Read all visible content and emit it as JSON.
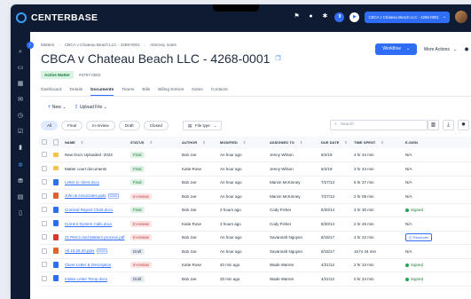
{
  "app": {
    "brand": "CENTERBASE"
  },
  "topbar": {
    "matter_pill": "CBCA v Chateau Beach LLC - 4268-0001",
    "counter_badge": "9"
  },
  "breadcrumb": [
    "Matters",
    "CBCA v Chateau Beach LLC - 4268-0001",
    "Attorney notes"
  ],
  "header": {
    "title": "CBCA v Chateau Beach LLC - 4268-0001",
    "status_badge": "Active Matter",
    "matter_number": "#3797-0002",
    "workflow_label": "Workflow",
    "more_actions_label": "More Actions"
  },
  "tabs": [
    {
      "label": "Dashboard",
      "active": false
    },
    {
      "label": "Details",
      "active": false
    },
    {
      "label": "Documents",
      "active": true
    },
    {
      "label": "Teams",
      "active": false
    },
    {
      "label": "Bills",
      "active": false
    },
    {
      "label": "Billing Entries",
      "active": false
    },
    {
      "label": "Notes",
      "active": false
    },
    {
      "label": "Contacts",
      "active": false
    }
  ],
  "toolbar": {
    "new_label": "New",
    "upload_label": "Upload File"
  },
  "filters": {
    "pills": [
      "All",
      "Final",
      "In-review",
      "Draft",
      "Closed"
    ],
    "active": "All",
    "filetype_label": "File type"
  },
  "search": {
    "placeholder": "Search"
  },
  "table": {
    "columns": [
      "NAME",
      "STATUS",
      "AUTHOR",
      "MODIFIED",
      "ASSIGNED TO",
      "DUE DATE",
      "TIME SPENT",
      "E-SIGN"
    ],
    "rows": [
      {
        "icon": "folder",
        "name": "New Docs Uploaded -2023",
        "link": false,
        "tag": "",
        "status": "Final",
        "author": "Bob Joe",
        "modified": "An hour ago",
        "assigned": "Jenny Wilson",
        "due": "8/2/19",
        "time": "4 hr 34 min",
        "esign": "N/A"
      },
      {
        "icon": "folder",
        "name": "Matter court documents",
        "link": false,
        "tag": "",
        "status": "Final",
        "author": "Katie Rose",
        "modified": "An hour ago",
        "assigned": "Jenny Wilson",
        "due": "8/2/19",
        "time": "3 hr 44 min",
        "esign": "N/A"
      },
      {
        "icon": "word",
        "name": "Letter to client.docx",
        "link": true,
        "tag": "",
        "status": "Final",
        "author": "Bob Joe",
        "modified": "An hour ago",
        "assigned": "Marvin McKinney",
        "due": "7/27/13",
        "time": "5 hr 37 min",
        "esign": "N/A"
      },
      {
        "icon": "ppt",
        "name": "John & Associates.pptx",
        "link": true,
        "tag": "SDDS",
        "status": "In-review",
        "author": "Bob Joe",
        "modified": "An hour ago",
        "assigned": "Marvin McKinney",
        "due": "7/27/13",
        "time": "2 hr 09 min",
        "esign": "N/A"
      },
      {
        "icon": "word",
        "name": "Criminal Report Chart.docx",
        "link": true,
        "tag": "",
        "status": "Final",
        "author": "Bob Joe",
        "modified": "2 hours ago",
        "assigned": "Cody Fisher",
        "due": "8/30/14",
        "time": "3 hr 30 min",
        "esign": "Signed"
      },
      {
        "icon": "word",
        "name": "Current System Calls.docx",
        "link": true,
        "tag": "",
        "status": "In-review",
        "author": "Katie Rose",
        "modified": "3 hours ago",
        "assigned": "Cody Fisher",
        "due": "8/30/14",
        "time": "2 hr 45 min",
        "esign": "N/A"
      },
      {
        "icon": "pdf",
        "name": "21 PNCs and Matters process.pdf",
        "link": true,
        "tag": "",
        "status": "In-review",
        "author": "Bob Joe",
        "modified": "An hour ago",
        "assigned": "Savannah Nguyen",
        "due": "8/15/17",
        "time": "4 hr 22 min",
        "esign": "Reminder"
      },
      {
        "icon": "ppt",
        "name": "All 10.28.20.pptx",
        "link": true,
        "tag": "SDDS",
        "status": "Draft",
        "author": "Bob Joe",
        "modified": "An hour ago",
        "assigned": "Savannah Nguyen",
        "due": "8/15/17",
        "time": "15 hr 34 min",
        "esign": "N/A"
      },
      {
        "icon": "word",
        "name": "Client Letter & Description",
        "link": true,
        "tag": "",
        "status": "In-review",
        "author": "Katie Rose",
        "modified": "40 min ago",
        "assigned": "Wade Warren",
        "due": "4/21/12",
        "time": "2 hr 34 min",
        "esign": "Signed"
      },
      {
        "icon": "word",
        "name": "Intake Letter Temp.docx",
        "link": true,
        "tag": "",
        "status": "Draft",
        "author": "Bob Joe",
        "modified": "20 min ago",
        "assigned": "Wade Warren",
        "due": "4/21/12",
        "time": "0 hr 24 min",
        "esign": "Signed"
      }
    ]
  },
  "colors": {
    "navy": "#0e1b33",
    "accent": "#2f6df6",
    "final": "#1a7a3d",
    "inreview": "#c13838"
  },
  "icons": [
    "centerbase-logo-icon",
    "flag-icon",
    "bell-icon",
    "help-icon",
    "play-icon",
    "chevron-down-icon",
    "search-icon",
    "gear-icon",
    "plus-icon",
    "upload-icon",
    "download-icon",
    "columns-icon",
    "copy-icon"
  ]
}
